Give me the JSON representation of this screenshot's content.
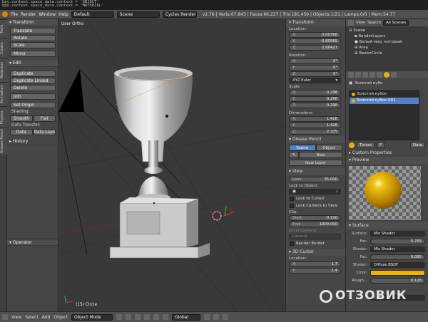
{
  "console": {
    "line1": "bpy.context.space_data.context = 'OBJECT'",
    "line2": "bpy.context.space_data.context = 'MATERIAL'"
  },
  "topbar": {
    "menus": [
      "File",
      "Render",
      "Window",
      "Help"
    ],
    "layout": "Default",
    "scene": "Scene",
    "engine": "Cycles Render",
    "stats": "v2.76 | Verts:67,843 | Faces:66,227 | Tris:191,450 | Objects:1/21 | Lamps:0/0 | Mem:54.77"
  },
  "tooltabs": [
    "Tools",
    "Create",
    "Relations",
    "Animation",
    "Physics",
    "Grease Pencil"
  ],
  "toolshelf": {
    "transform_header": "Transform",
    "transform_buttons": [
      "Translate",
      "Rotate",
      "Scale",
      "Mirror"
    ],
    "edit_header": "Edit",
    "edit_buttons": [
      "Duplicate",
      "Duplicate Linked",
      "Delete",
      "Join",
      "Set Origin"
    ],
    "shading_label": "Shading:",
    "shading_buttons": [
      "Smooth",
      "Flat"
    ],
    "datatransfer_label": "Data Transfer:",
    "datatransfer_buttons": [
      "Data",
      "Data Layo"
    ],
    "history_header": "History",
    "operator_header": "Operator"
  },
  "viewport": {
    "view_label": "User Ortho",
    "object_label": "(15) Circle"
  },
  "npanel": {
    "transform_header": "Transform",
    "location_label": "Location:",
    "location": [
      {
        "k": "X:",
        "v": "0.00768"
      },
      {
        "k": "Y:",
        "v": "-0.80569"
      },
      {
        "k": "Z:",
        "v": "2.88427"
      }
    ],
    "rotation_label": "Rotation:",
    "rotation": [
      {
        "k": "X:",
        "v": "0°"
      },
      {
        "k": "Y:",
        "v": "0°"
      },
      {
        "k": "Z:",
        "v": "0°"
      }
    ],
    "rotation_mode": "XYZ Euler",
    "scale_label": "Scale:",
    "scale": [
      {
        "k": "X:",
        "v": "0.298"
      },
      {
        "k": "Y:",
        "v": "0.298"
      },
      {
        "k": "Z:",
        "v": "0.298"
      }
    ],
    "dimensions_label": "Dimensions:",
    "dimensions": [
      {
        "k": "X:",
        "v": "1.428"
      },
      {
        "k": "Y:",
        "v": "1.428"
      },
      {
        "k": "Z:",
        "v": "2.375"
      }
    ],
    "grease_header": "Grease Pencil",
    "grease_tabs": [
      "Scene",
      "Object"
    ],
    "new_label": "New",
    "new_layer": "New Layer",
    "view_header": "View",
    "lens_k": "Lens:",
    "lens_v": "35.000",
    "lock_obj_label": "Lock to Object:",
    "lock_cursor": "Lock to Cursor",
    "lock_camera": "Lock Camera to View",
    "clip_label": "Clip:",
    "clip_start_k": "Start:",
    "clip_start_v": "0.100",
    "clip_end_k": "End:",
    "clip_end_v": "1000.000",
    "local_camera_label": "Local Camera:",
    "local_camera_value": "Camera",
    "render_border": "Render Border",
    "cursor_header": "3D Cursor",
    "cursor_location_label": "Location:",
    "cursor": [
      {
        "k": "X:",
        "v": "1.7"
      },
      {
        "k": "Y:",
        "v": "1.4"
      }
    ]
  },
  "right": {
    "header_tabs": [
      "View",
      "Search",
      "All Scenes"
    ],
    "outliner": [
      "Scene",
      "RenderLayers",
      "Белый мир, который",
      "Area",
      "BezierCircle"
    ],
    "props_name": "Золотой кубо",
    "materials": [
      "Золотой кубок",
      "Золотой кубок.001"
    ],
    "slot_name": "Точно",
    "slot_count": "F",
    "slot_data": "Data",
    "custom_props": "Custom Properties",
    "preview_header": "Preview",
    "surface_header": "Surface",
    "surface_label": "Surface:",
    "surface_value": "Mix Shader",
    "fac1_label": "Fac:",
    "fac1_value": "0.755",
    "shader1_label": "Shader:",
    "shader1_value": "Mix Shader",
    "fac2_label": "Fac:",
    "fac2_value": "0.095",
    "shader2_label": "Shader:",
    "shader2_value": "Diffuse BSDF",
    "color_label": "Color:",
    "color_value": "#f2b400",
    "rough_label": "Rough...",
    "rough_value": "0.128",
    "cubic_value": "Cubic"
  },
  "bottombar": {
    "menus": [
      "View",
      "Select",
      "Add",
      "Object"
    ],
    "mode": "Object Mode",
    "orientation": "Global"
  },
  "watermark": "ОТЗОВИК"
}
